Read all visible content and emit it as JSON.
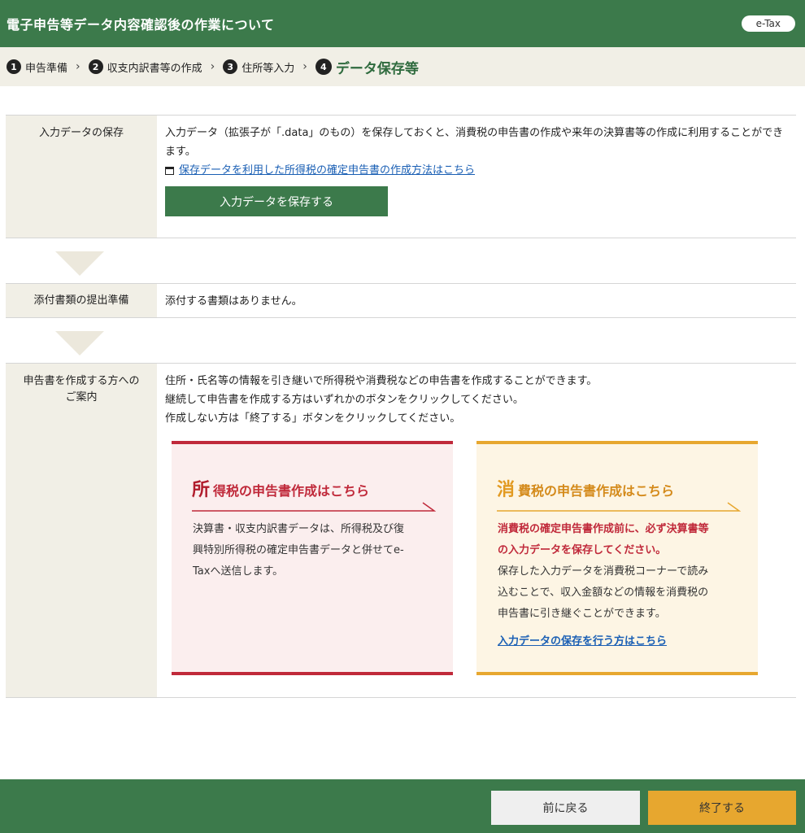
{
  "header": {
    "title": "電子申告等データ内容確認後の作業について",
    "badge": "e-Tax"
  },
  "steps": [
    {
      "num": "1",
      "label": "申告準備"
    },
    {
      "num": "2",
      "label": "収支内訳書等の作成"
    },
    {
      "num": "3",
      "label": "住所等入力"
    },
    {
      "num": "4",
      "label": "データ保存等"
    }
  ],
  "step_separator": "›",
  "save_section": {
    "label": "入力データの保存",
    "text": "入力データ（拡張子が「.data」のもの）を保存しておくと、消費税の申告書の作成や来年の決算書等の作成に利用することができます。",
    "link": "保存データを利用した所得税の確定申告書の作成方法はこちら",
    "button": "入力データを保存する"
  },
  "attach_section": {
    "label": "添付書類の提出準備",
    "text": "添付する書類はありません。"
  },
  "guide_section": {
    "label_line1": "申告書を作成する方への",
    "label_line2": "ご案内",
    "line1": "住所・氏名等の情報を引き継いで所得税や消費税などの申告書を作成することができます。",
    "line2": "継続して申告書を作成する方はいずれかのボタンをクリックしてください。",
    "line3": "作成しない方は「終了する」ボタンをクリックしてください。"
  },
  "card_income": {
    "title_big": "所",
    "title_rest": "得税の申告書作成はこちら",
    "line1": "決算書・収支内訳書データは、所得税及び復",
    "line2": "興特別所得税の確定申告書データと併せてe-",
    "line3": "Taxへ送信します。"
  },
  "card_consumption": {
    "title_big": "消",
    "title_rest": "費税の申告書作成はこちら",
    "warn1": "消費税の確定申告書作成前に、必ず決算書等",
    "warn2": "の入力データを保存してください。",
    "line1": "保存した入力データを消費税コーナーで読み",
    "line2": "込むことで、収入金額などの情報を消費税の",
    "line3": "申告書に引き継ぐことができます。",
    "link": "入力データの保存を行う方はこちら"
  },
  "footer": {
    "back": "前に戻る",
    "end": "終了する"
  },
  "colors": {
    "primary_green": "#3c7a4b",
    "accent_red": "#c0293a",
    "accent_orange": "#e7a72f",
    "link_blue": "#1a5fb4"
  }
}
